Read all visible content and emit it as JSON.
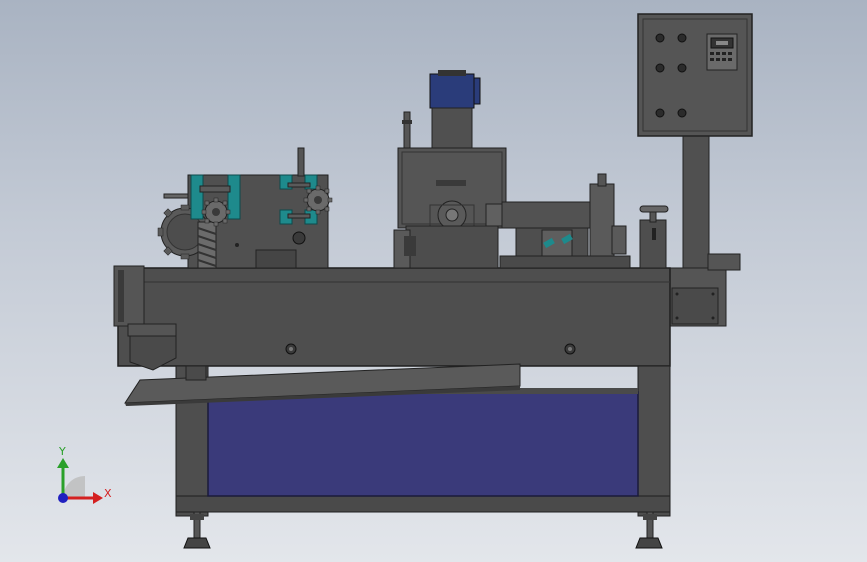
{
  "viewport": {
    "background": "#b9c1ce",
    "model_color": "#4d4d4d",
    "panel_color": "#3a3a7a",
    "accent_color": "#1e8a8c",
    "motor_color": "#2a3c7a"
  },
  "triad": {
    "x_label": "X",
    "y_label": "Y",
    "x_color": "#d42020",
    "y_color": "#2aa02a",
    "z_color": "#2020c0",
    "icon": "coordinate-triad-icon"
  }
}
